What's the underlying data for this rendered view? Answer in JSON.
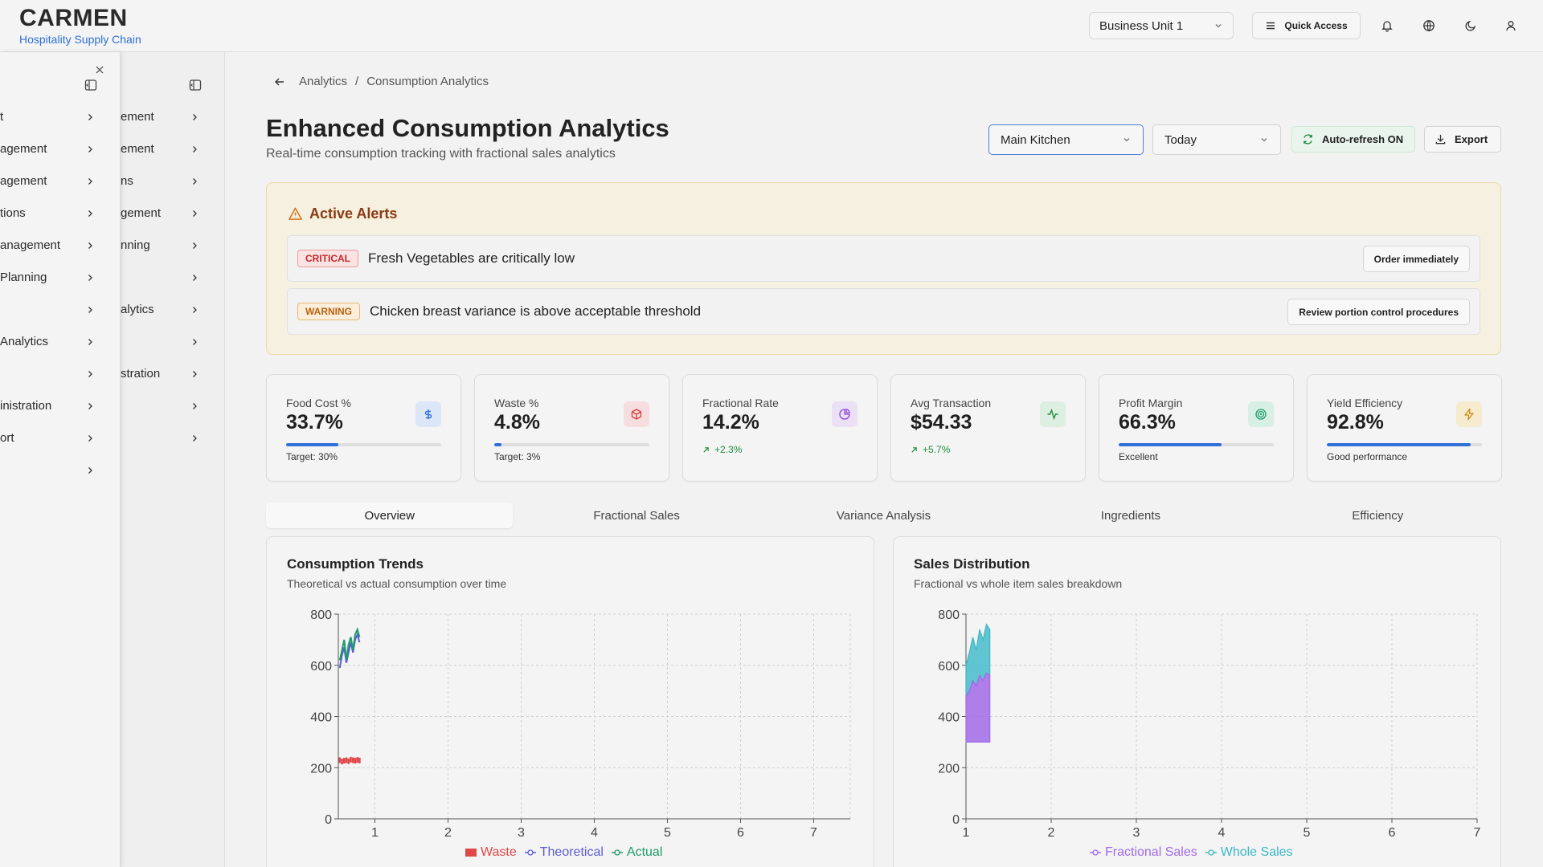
{
  "app": {
    "brand_name": "CARMEN",
    "brand_sub": "Hospitality Supply Chain",
    "business_unit": "Business Unit 1",
    "quick_access_label": "Quick Access"
  },
  "sidebar_back": {
    "items": [
      "ement",
      "ement",
      "ns",
      "gement",
      "nning",
      "",
      "alytics",
      "",
      "stration",
      "",
      ""
    ]
  },
  "sidebar_front": {
    "items": [
      "t",
      "agement",
      "agement",
      "tions",
      "anagement",
      "Planning",
      "",
      "Analytics",
      "",
      "inistration",
      "ort",
      ""
    ]
  },
  "breadcrumb": {
    "root": "Analytics",
    "separator": "/",
    "current": "Consumption Analytics"
  },
  "page": {
    "title": "Enhanced Consumption Analytics",
    "subtitle": "Real-time consumption tracking with fractional sales analytics"
  },
  "controls": {
    "location": "Main Kitchen",
    "period": "Today",
    "auto_refresh_label": "Auto-refresh ON",
    "export_label": "Export"
  },
  "alerts": {
    "title": "Active Alerts",
    "items": [
      {
        "level": "CRITICAL",
        "text": "Fresh Vegetables are critically low",
        "action": "Order immediately"
      },
      {
        "level": "WARNING",
        "text": "Chicken breast variance is above acceptable threshold",
        "action": "Review portion control procedures"
      }
    ]
  },
  "kpis": [
    {
      "label": "Food Cost %",
      "value": "33.7%",
      "foot": "Target: 30%",
      "progress": 0.337,
      "icon": "dollar-icon",
      "icon_color": "#2f6fd6",
      "icon_bg": "#dbe6f8"
    },
    {
      "label": "Waste %",
      "value": "4.8%",
      "foot": "Target: 3%",
      "progress": 0.048,
      "icon": "box-icon",
      "icon_color": "#d63b3b",
      "icon_bg": "#f6dede"
    },
    {
      "label": "Fractional Rate",
      "value": "14.2%",
      "trend": "+2.3%",
      "icon": "pie-icon",
      "icon_color": "#8b45d6",
      "icon_bg": "#ebe0f6"
    },
    {
      "label": "Avg Transaction",
      "value": "$54.33",
      "trend": "+5.7%",
      "icon": "activity-icon",
      "icon_color": "#1e8b3e",
      "icon_bg": "#dcefe1"
    },
    {
      "label": "Profit Margin",
      "value": "66.3%",
      "foot": "Excellent",
      "progress": 0.663,
      "icon": "target-icon",
      "icon_color": "#1e9b6b",
      "icon_bg": "#d8efe5"
    },
    {
      "label": "Yield Efficiency",
      "value": "92.8%",
      "foot": "Good performance",
      "progress": 0.928,
      "icon": "zap-icon",
      "icon_color": "#c98a0e",
      "icon_bg": "#f6ebcf"
    }
  ],
  "tabs": [
    "Overview",
    "Fractional Sales",
    "Variance Analysis",
    "Ingredients",
    "Efficiency"
  ],
  "colors": {
    "waste": "#e04848",
    "theoretical": "#5b5bd6",
    "actual": "#1e9b6b",
    "fractional": "#a16ae8",
    "whole": "#3bb8c8"
  },
  "chart_data": [
    {
      "type": "line",
      "title": "Consumption Trends",
      "subtitle": "Theoretical vs actual consumption over time",
      "xlim": [
        0.5,
        7.5
      ],
      "xticks": [
        1,
        2,
        3,
        4,
        5,
        6,
        7
      ],
      "ylim": [
        0,
        800
      ],
      "yticks": [
        0,
        200,
        400,
        600,
        800
      ],
      "grid": true,
      "legend_position": "bottom",
      "series": [
        {
          "name": "Waste",
          "kind": "bar",
          "x": [
            0.52,
            0.55,
            0.58,
            0.61,
            0.64,
            0.67,
            0.7,
            0.73,
            0.76,
            0.79
          ],
          "values": [
            240,
            235,
            238,
            240,
            236,
            242,
            240,
            238,
            241,
            239
          ]
        },
        {
          "name": "Theoretical",
          "kind": "line",
          "x": [
            0.52,
            0.55,
            0.58,
            0.61,
            0.64,
            0.67,
            0.7,
            0.73,
            0.76,
            0.79
          ],
          "values": [
            590,
            640,
            670,
            610,
            650,
            690,
            650,
            700,
            720,
            690
          ]
        },
        {
          "name": "Actual",
          "kind": "line",
          "x": [
            0.52,
            0.55,
            0.58,
            0.61,
            0.64,
            0.67,
            0.7,
            0.73,
            0.76,
            0.79
          ],
          "values": [
            620,
            660,
            700,
            620,
            680,
            710,
            660,
            720,
            740,
            710
          ]
        }
      ]
    },
    {
      "type": "area",
      "title": "Sales Distribution",
      "subtitle": "Fractional vs whole item sales breakdown",
      "xlim": [
        1,
        7
      ],
      "xticks": [
        1,
        2,
        3,
        4,
        5,
        6,
        7
      ],
      "ylim": [
        0,
        800
      ],
      "yticks": [
        0,
        200,
        400,
        600,
        800
      ],
      "grid": true,
      "legend_position": "bottom",
      "stacked": true,
      "baseline": 300,
      "series": [
        {
          "name": "Fractional Sales",
          "x": [
            1.0,
            1.04,
            1.08,
            1.12,
            1.16,
            1.2,
            1.24,
            1.28
          ],
          "values": [
            480,
            500,
            540,
            520,
            560,
            540,
            570,
            560
          ]
        },
        {
          "name": "Whole Sales",
          "x": [
            1.0,
            1.04,
            1.08,
            1.12,
            1.16,
            1.2,
            1.24,
            1.28
          ],
          "values": [
            600,
            650,
            710,
            660,
            740,
            700,
            760,
            740
          ]
        }
      ]
    }
  ]
}
